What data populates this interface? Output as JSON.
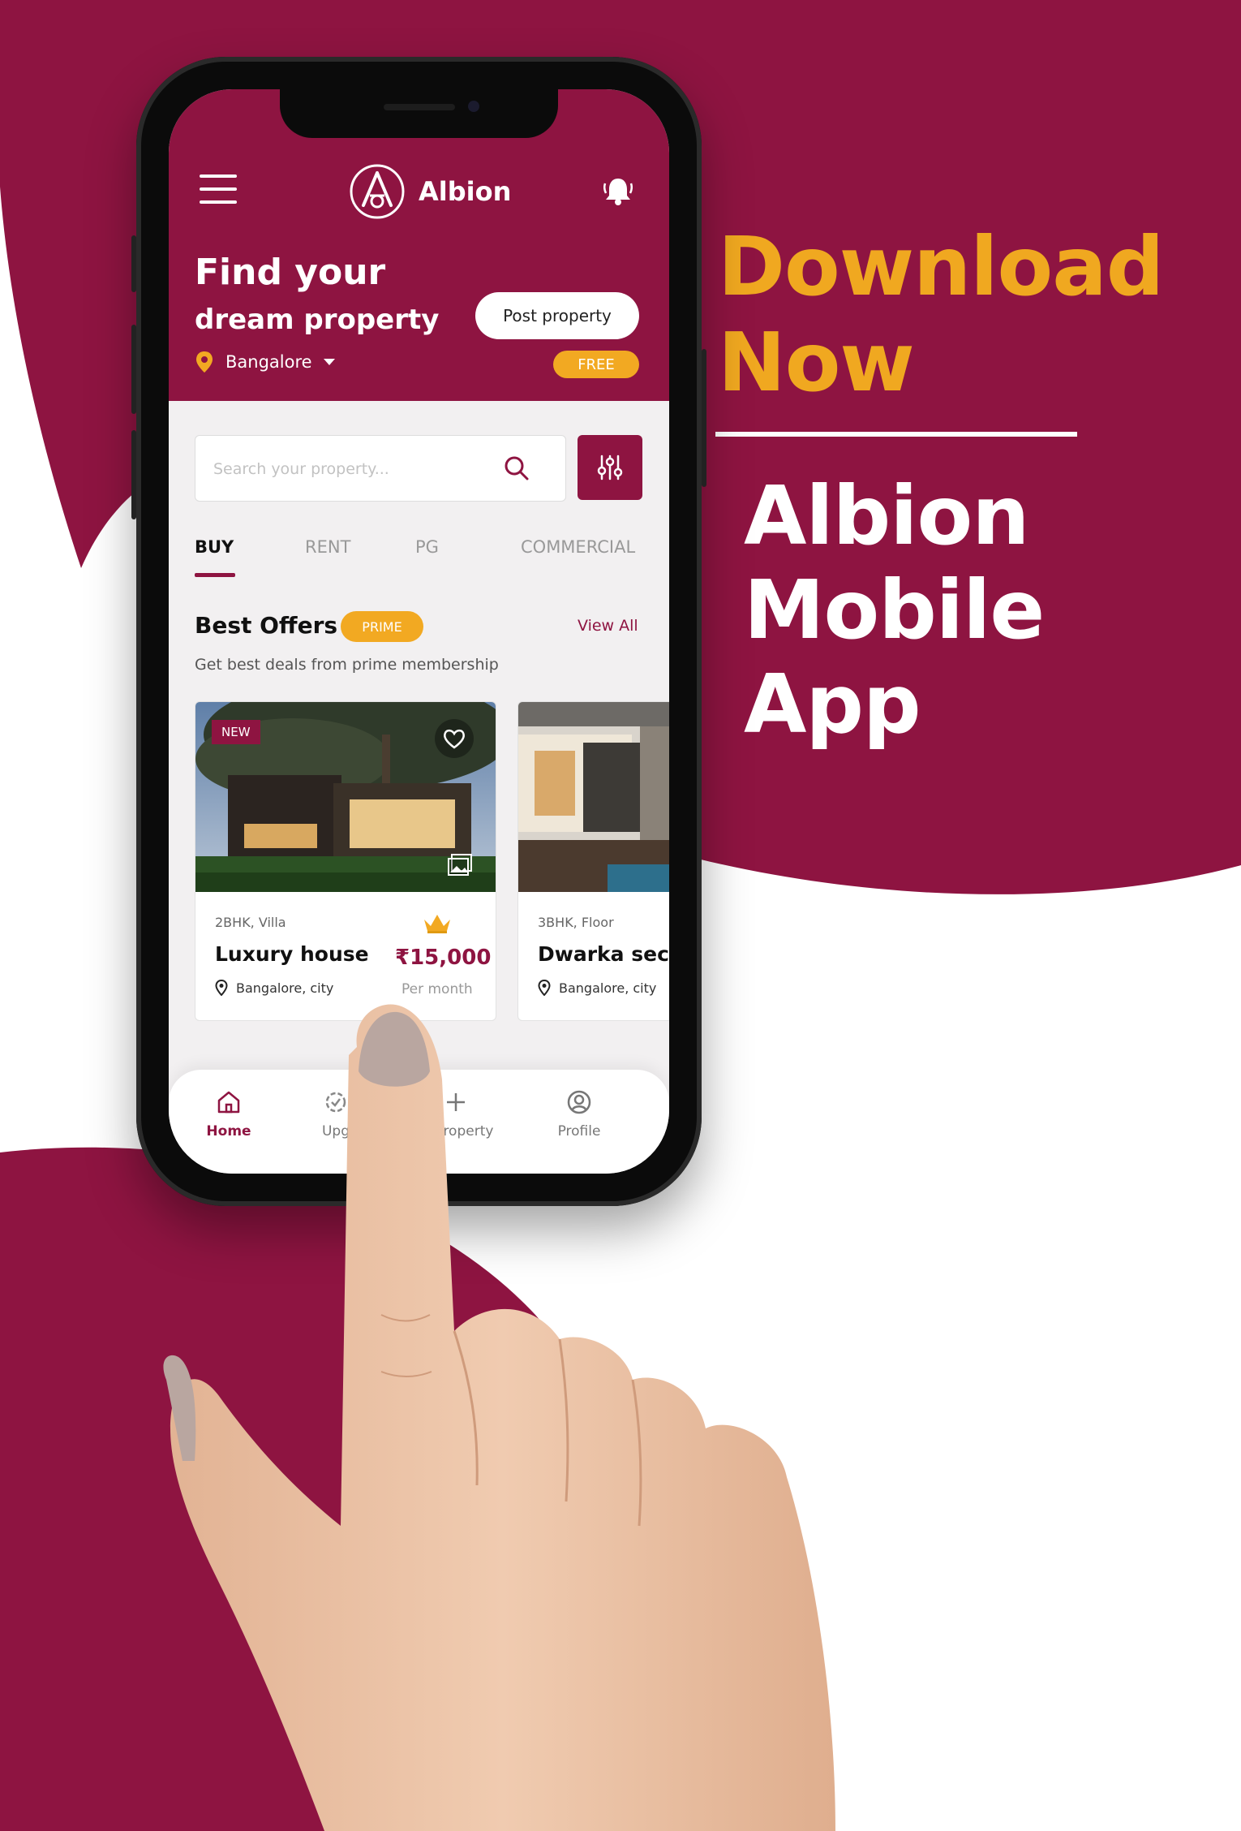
{
  "colors": {
    "brand": "#8E1441",
    "accent": "#F2A922",
    "promo_accent": "#F0A820"
  },
  "promo": {
    "download_line1": "Download",
    "download_line2": "Now",
    "app_line1": "Albion",
    "app_line2": "Mobile",
    "app_line3": "App"
  },
  "app": {
    "header": {
      "menu_icon": "hamburger-menu-icon",
      "brand_name": "Albion",
      "notification_icon": "bell-icon",
      "headline_line1": "Find your",
      "headline_line2": "dream property",
      "location": "Bangalore",
      "post_property_label": "Post property",
      "free_badge": "FREE"
    },
    "search": {
      "placeholder": "Search your property...",
      "value": ""
    },
    "tabs": [
      {
        "label": "BUY",
        "active": true
      },
      {
        "label": "RENT",
        "active": false
      },
      {
        "label": "PG",
        "active": false
      },
      {
        "label": "COMMERCIAL",
        "active": false
      }
    ],
    "offers": {
      "title": "Best Offers",
      "badge": "PRIME",
      "view_all": "View All",
      "subtitle": "Get best deals from prime membership"
    },
    "cards": [
      {
        "badge": "NEW",
        "type": "2BHK, Villa",
        "title": "Luxury house",
        "location": "Bangalore, city",
        "price": "₹15,000",
        "price_note": "Per month"
      },
      {
        "type": "3BHK, Floor",
        "title": "Dwarka sect",
        "location": "Bangalore, city"
      }
    ],
    "bottom_nav": [
      {
        "label": "Home",
        "icon": "home-icon",
        "active": true
      },
      {
        "label": "Upg",
        "icon": "upgrade-badge-icon",
        "active": false
      },
      {
        "label": "st Property",
        "icon": "plus-icon",
        "active": false
      },
      {
        "label": "Profile",
        "icon": "profile-icon",
        "active": false
      }
    ]
  }
}
